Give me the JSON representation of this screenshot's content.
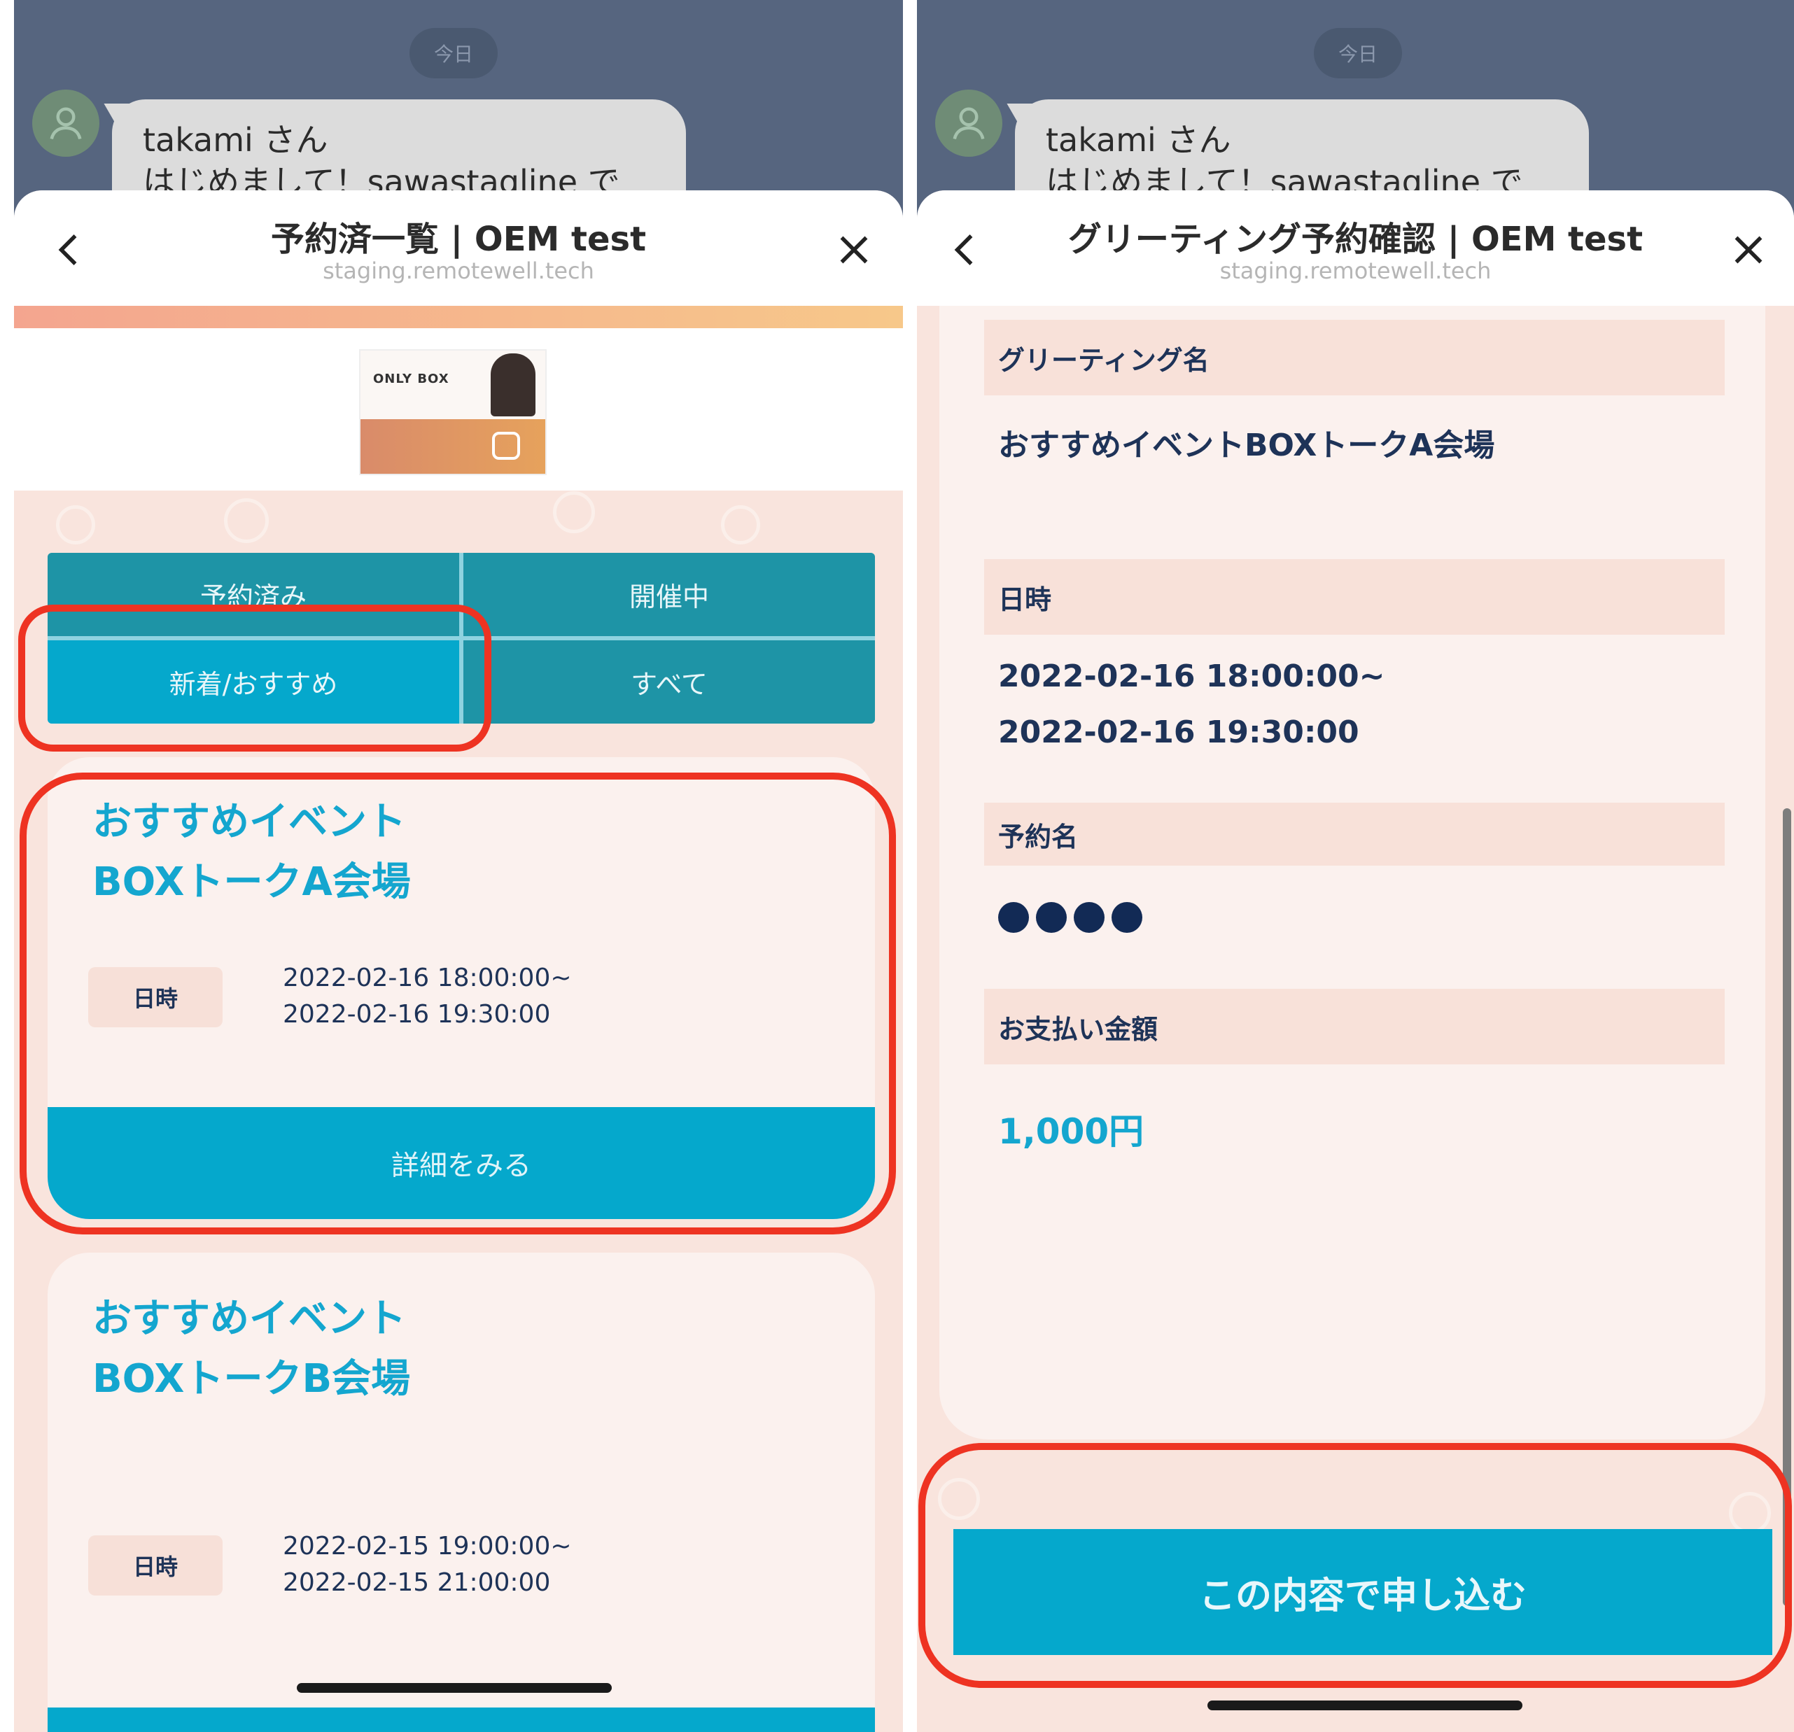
{
  "colors": {
    "accent": "#05a8cc",
    "tab": "#1e94a6",
    "highlight_outline": "#ee3322",
    "text_dark": "#1e3358",
    "chat_bg": "#56657f",
    "sheet_bg": "#f9e4dd"
  },
  "left": {
    "chat": {
      "date": "今日",
      "bubble_line1": "takami さん",
      "bubble_line2": "はじめまして！sawastagline で"
    },
    "sheet": {
      "title": "予約済一覧 | OEM test",
      "url": "staging.remotewell.tech",
      "back_icon": "chevron-left-icon",
      "close_icon": "close-icon"
    },
    "tabs": [
      {
        "label": "予約済み"
      },
      {
        "label": "開催中"
      },
      {
        "label": "新着/おすすめ"
      },
      {
        "label": "すべて"
      }
    ],
    "events": [
      {
        "title_line1": "おすすめイベント",
        "title_line2": "BOXトークA会場",
        "date_label": "日時",
        "start": "2022-02-16 18:00:00~",
        "end": "2022-02-16 19:30:00",
        "button": "詳細をみる"
      },
      {
        "title_line1": "おすすめイベント",
        "title_line2": "BOXトークB会場",
        "date_label": "日時",
        "start": "2022-02-15 19:00:00~",
        "end": "2022-02-15 21:00:00"
      }
    ]
  },
  "right": {
    "chat": {
      "date": "今日",
      "bubble_line1": "takami さん",
      "bubble_line2": "はじめまして！sawastagline で"
    },
    "sheet": {
      "title": "グリーティング予約確認 | OEM test",
      "url": "staging.remotewell.tech",
      "back_icon": "chevron-left-icon",
      "close_icon": "close-icon"
    },
    "details": {
      "greeting_name_label": "グリーティング名",
      "greeting_name": "おすすめイベントBOXトークA会場",
      "datetime_label": "日時",
      "start": "2022-02-16 18:00:00~",
      "end": "2022-02-16 19:30:00",
      "reservation_name_label": "予約名",
      "reservation_name_masked": "●●●●",
      "payment_label": "お支払い金額",
      "payment_amount": "1,000円"
    },
    "submit_button": "この内容で申し込む"
  }
}
